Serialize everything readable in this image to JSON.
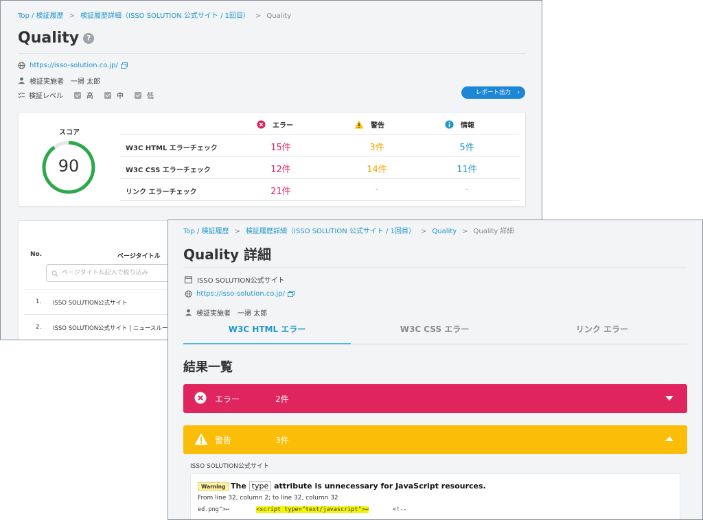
{
  "quality": {
    "breadcrumb": {
      "top": "Top / 検証履歴",
      "history": "検証履歴詳細（ISSO SOLUTION 公式サイト / 1回目）",
      "current": "Quality"
    },
    "title": "Quality",
    "help": "?",
    "url": "https://isso-solution.co.jp/",
    "inspector_label": "検証実施者",
    "inspector": "一掃 太郎",
    "level_label": "検証レベル",
    "levels": [
      "高",
      "中",
      "低"
    ],
    "report_button": "レポート出力",
    "score_label": "スコア",
    "score": "90",
    "summary": {
      "headers": {
        "error": "エラー",
        "warning": "警告",
        "info": "情報"
      },
      "rows": [
        {
          "name": "W3C HTML エラーチェック",
          "error": "15件",
          "warning": "3件",
          "info": "5件"
        },
        {
          "name": "W3C CSS エラーチェック",
          "error": "12件",
          "warning": "14件",
          "info": "11件"
        },
        {
          "name": "リンク エラーチェック",
          "error": "21件",
          "warning": "-",
          "info": "-"
        }
      ]
    },
    "pages": {
      "col_no": "No.",
      "col_title": "ページタイトル",
      "filter_placeholder": "ページタイトル記入で絞り込み",
      "rows": [
        {
          "no": "1.",
          "title": "ISSO SOLUTION公式サイト"
        },
        {
          "no": "2.",
          "title": "ISSO SOLUTION公式サイト | ニュースルーム | コ"
        }
      ]
    }
  },
  "detail": {
    "breadcrumb": {
      "top": "Top / 検証履歴",
      "history": "検証履歴詳細（ISSO SOLUTION 公式サイト / 1回目）",
      "quality": "Quality",
      "current": "Quality 詳細"
    },
    "title": "Quality 詳細",
    "site": "ISSO SOLUTION公式サイト",
    "url": "https://isso-solution.co.jp/",
    "inspector_label": "検証実施者",
    "inspector": "一掃 太郎",
    "tabs": [
      "W3C HTML エラー",
      "W3C CSS エラー",
      "リンク エラー"
    ],
    "section_title": "結果一覧",
    "error_bar": {
      "label": "エラー",
      "count": "2件"
    },
    "warning_bar": {
      "label": "警告",
      "count": "3件"
    },
    "site_label": "ISSO SOLUTION公式サイト",
    "warning_item": {
      "badge": "Warning",
      "msg_pre": "The",
      "msg_code": "type",
      "msg_post": "attribute is unnecessary for JavaScript resources.",
      "location": "From line 32, column 2; to line 32, column 32",
      "code_pre": "ed.png\">↩",
      "code_hl": "<script type=\"text/javascript\">↩",
      "code_post": "<!--"
    }
  },
  "colors": {
    "error": "#e0245e",
    "warning": "#fbbd08",
    "info": "#2196c9",
    "accent": "#1d87d6"
  }
}
